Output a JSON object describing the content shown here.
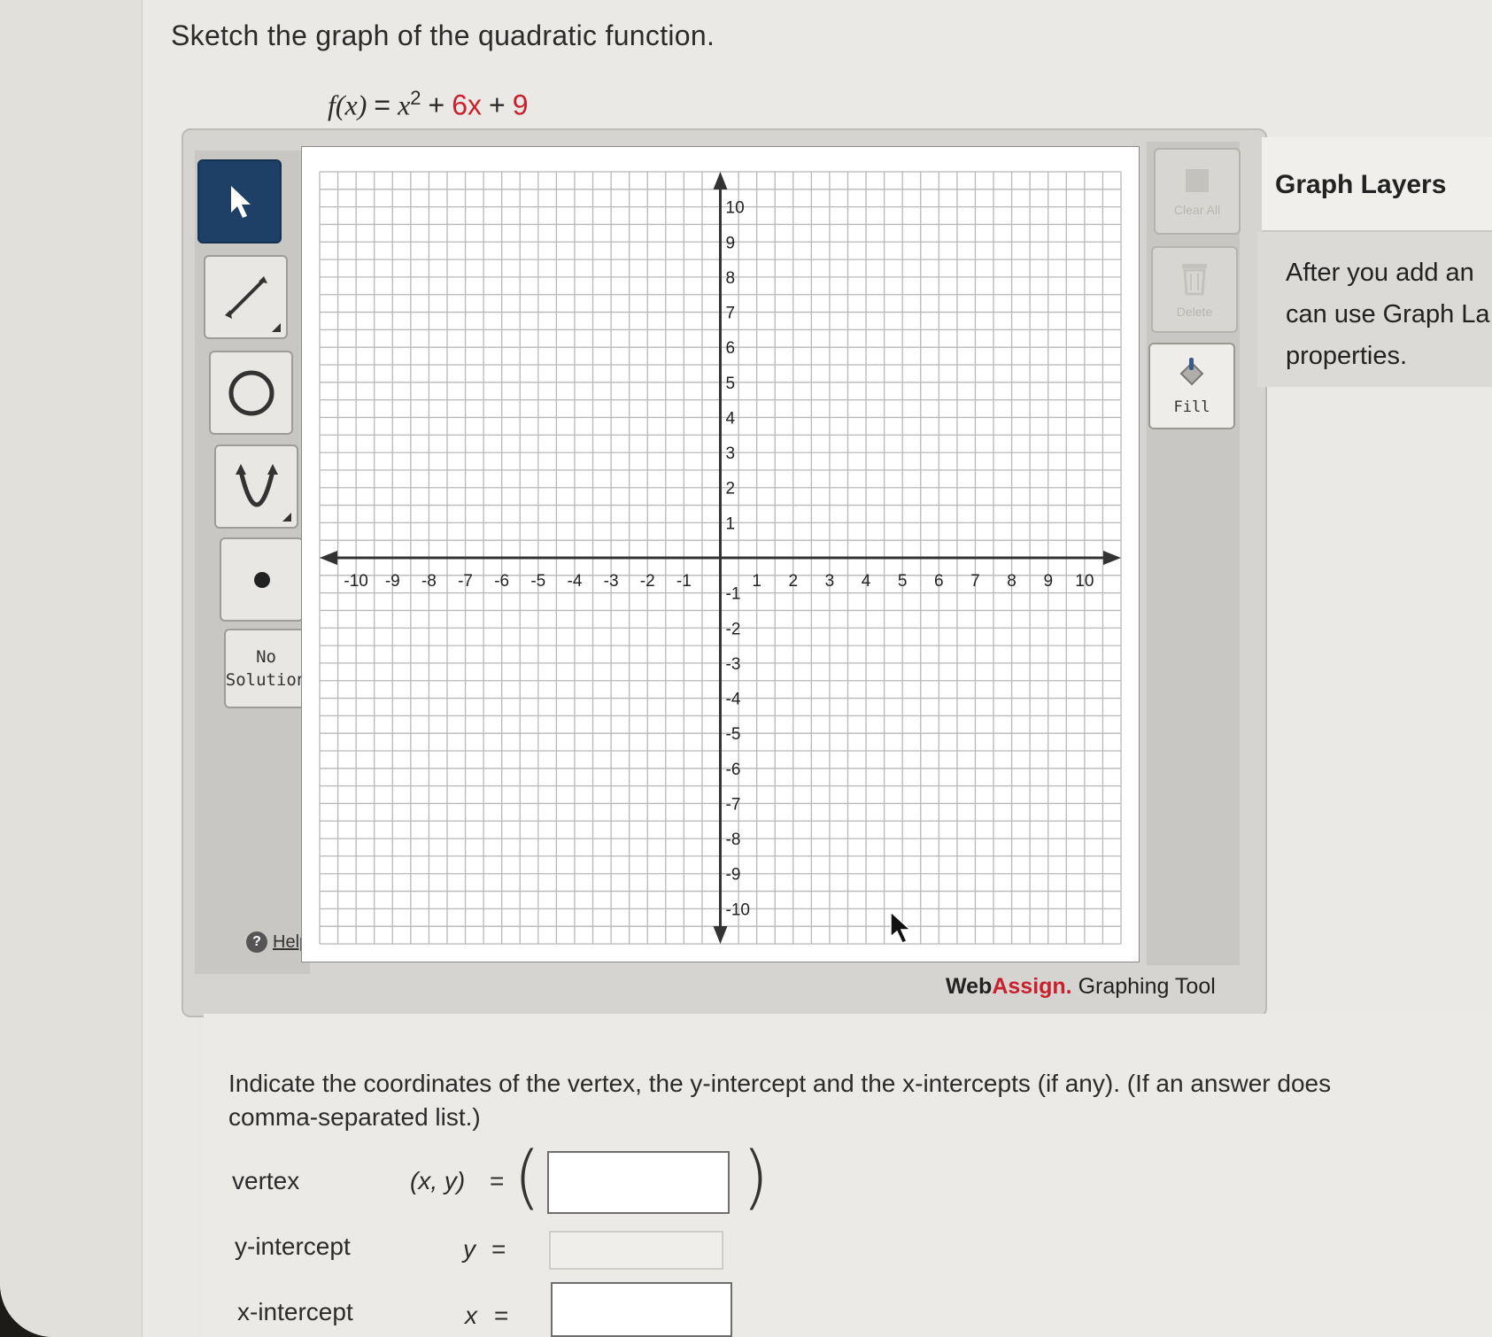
{
  "prompt": "Sketch the graph of the quadratic function.",
  "function": {
    "lhs": "f(x)",
    "eq": "=",
    "x": "x",
    "exp": "2",
    "plus1": "+",
    "term2": "6x",
    "plus2": "+",
    "term3": "9"
  },
  "toolbar": {
    "tools": [
      "pointer-tool",
      "line-tool",
      "circle-tool",
      "parabola-tool",
      "point-tool"
    ],
    "no_solution_line1": "No",
    "no_solution_line2": "Solution",
    "help_label": "Help"
  },
  "right_tools": {
    "clear_all": "Clear All",
    "delete": "Delete",
    "fill": "Fill"
  },
  "graph": {
    "x_range": [
      -10,
      10
    ],
    "y_range": [
      -10,
      10
    ],
    "x_ticks": [
      "-10",
      "-9",
      "-8",
      "-7",
      "-6",
      "-5",
      "-4",
      "-3",
      "-2",
      "-1",
      "1",
      "2",
      "3",
      "4",
      "5",
      "6",
      "7",
      "8",
      "9",
      "10"
    ],
    "y_ticks": [
      "10",
      "9",
      "8",
      "7",
      "6",
      "5",
      "4",
      "3",
      "2",
      "1",
      "-1",
      "-2",
      "-3",
      "-4",
      "-5",
      "-6",
      "-7",
      "-8",
      "-9",
      "-10"
    ],
    "grid": true,
    "grid_color": "#b8b8b8",
    "axis_color": "#333333"
  },
  "branding": {
    "web": "Web",
    "assign": "Assign.",
    "rest": "Graphing Tool",
    "accent_color": "#c8202f"
  },
  "layers": {
    "title": "Graph Layers",
    "line1": "After you add an",
    "line2": "can use Graph La",
    "line3": "properties."
  },
  "question": {
    "instr_line1": "Indicate the coordinates of the vertex, the y-intercept and the x-intercepts (if any). (If an answer does",
    "instr_line2": "comma-separated list.)",
    "vertex_label": "vertex",
    "vertex_expr": "(x, y)",
    "eq": "=",
    "open_paren": "(",
    "close_paren": ")",
    "vertex_value": "",
    "yint_label": "y-intercept",
    "yint_var": "y",
    "yint_value": "",
    "xint_label": "x-intercept",
    "xint_var": "x",
    "xint_value": ""
  },
  "accent": {
    "tool_active": "#1e3f66",
    "brand_red": "#c8202f"
  }
}
